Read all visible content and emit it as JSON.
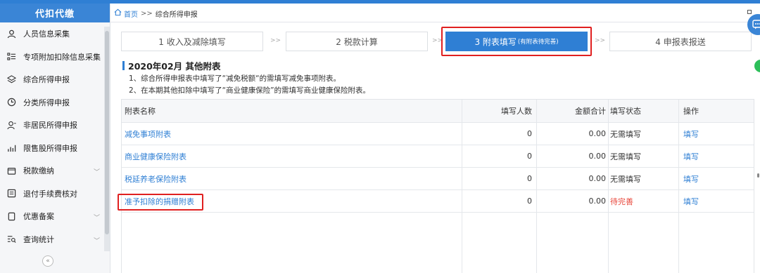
{
  "sidebar": {
    "title": "代扣代缴",
    "items": [
      {
        "label": "人员信息采集",
        "icon": "person-icon"
      },
      {
        "label": "专项附加扣除信息采集",
        "icon": "list-icon"
      },
      {
        "label": "综合所得申报",
        "icon": "layers-icon"
      },
      {
        "label": "分类所得申报",
        "icon": "clock-icon"
      },
      {
        "label": "非居民所得申报",
        "icon": "person-outline-icon"
      },
      {
        "label": "限售股所得申报",
        "icon": "bar-chart-icon"
      },
      {
        "label": "税款缴纳",
        "icon": "folder-icon",
        "expandable": true
      },
      {
        "label": "退付手续费核对",
        "icon": "document-icon"
      },
      {
        "label": "优惠备案",
        "icon": "file-icon",
        "expandable": true
      },
      {
        "label": "查询统计",
        "icon": "search-list-icon",
        "expandable": true
      }
    ],
    "collapse_symbol": "«"
  },
  "breadcrumb": {
    "home": "首页",
    "separator": ">>",
    "current": "综合所得申报"
  },
  "steps": [
    {
      "label": "1 收入及减除填写",
      "active": false
    },
    {
      "label": "2 税款计算",
      "active": false
    },
    {
      "label": "3 附表填写",
      "sub": "(有附表待完善)",
      "active": true
    },
    {
      "label": "4 申报表报送",
      "active": false
    }
  ],
  "step_separator": ">>",
  "section": {
    "title": "2020年02月 其他附表",
    "notes": [
      "1、综合所得申报表中填写了“减免税额“的需填写减免事项附表。",
      "2、在本期其他扣除中填写了“商业健康保险”的需填写商业健康保险附表。"
    ]
  },
  "table": {
    "headers": {
      "name": "附表名称",
      "count": "填写人数",
      "amount": "金额合计",
      "status": "填写状态",
      "op": "操作"
    },
    "rows": [
      {
        "name": "减免事项附表",
        "count": "0",
        "amount": "0.00",
        "status": "无需填写",
        "op": "填写",
        "warn": false
      },
      {
        "name": "商业健康保险附表",
        "count": "0",
        "amount": "0.00",
        "status": "无需填写",
        "op": "填写",
        "warn": false
      },
      {
        "name": "税延养老保险附表",
        "count": "0",
        "amount": "0.00",
        "status": "无需填写",
        "op": "填写",
        "warn": false
      },
      {
        "name": "准予扣除的捐赠附表",
        "count": "0",
        "amount": "0.00",
        "status": "待完善",
        "op": "填写",
        "warn": true
      }
    ]
  },
  "colors": {
    "primary": "#2f7fd4",
    "highlight": "#e02020",
    "warn": "#e8463a"
  }
}
